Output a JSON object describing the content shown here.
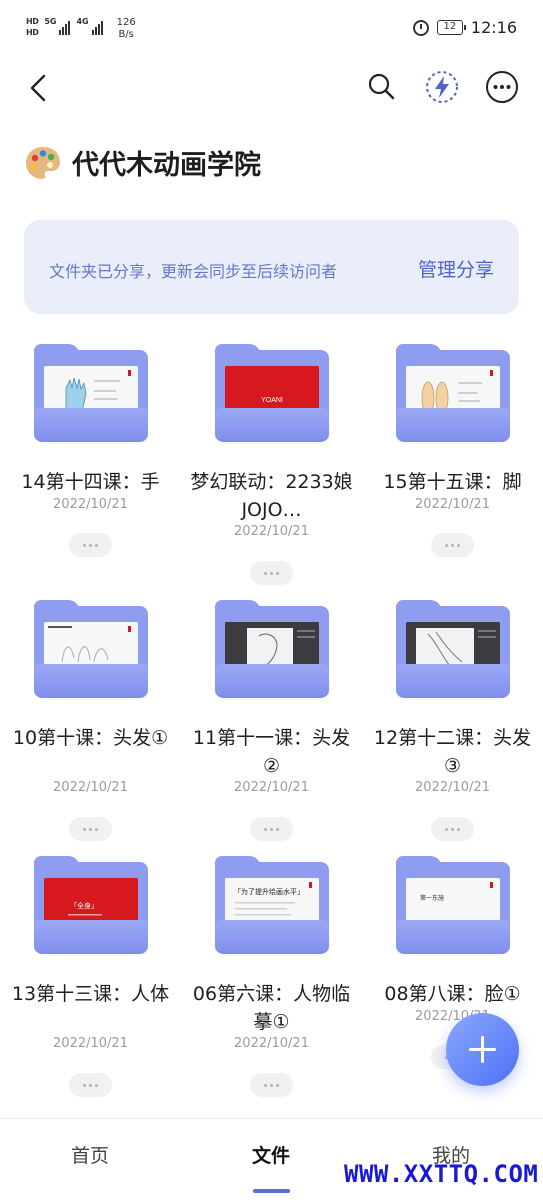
{
  "status_bar": {
    "sim1": "HD",
    "sim2": "HD",
    "net1": "5G",
    "net2": "4G",
    "speed_value": "126",
    "speed_unit": "B/s",
    "battery": "12",
    "time": "12:16"
  },
  "header": {
    "icons": [
      "back-arrow-icon",
      "search-icon",
      "lightning-icon",
      "more-icon"
    ]
  },
  "folder": {
    "emoji": "🎨",
    "title": "代代木动画学院"
  },
  "share_banner": {
    "message": "文件夹已分享，更新会同步至后续访问者",
    "action": "管理分享"
  },
  "items": [
    {
      "name": "14第十四课：手",
      "date": "2022/10/21",
      "thumb": "hand"
    },
    {
      "name": "梦幻联动：2233娘JOJO…",
      "date": "2022/10/21",
      "thumb": "red",
      "thumb_text": "YOANI"
    },
    {
      "name": "15第十五课：脚",
      "date": "2022/10/21",
      "thumb": "feet"
    },
    {
      "name": "10第十课：头发①",
      "date": "2022/10/21",
      "thumb": "sketch"
    },
    {
      "name": "11第十一课：头发②",
      "date": "2022/10/21",
      "thumb": "dark"
    },
    {
      "name": "12第十二课：头发③",
      "date": "2022/10/21",
      "thumb": "dark"
    },
    {
      "name": "13第十三课：人体",
      "date": "2022/10/21",
      "thumb": "red",
      "thumb_text": "「全身」"
    },
    {
      "name": "06第六课：人物临摹①",
      "date": "2022/10/21",
      "thumb": "white",
      "thumb_text": "「为了提升绘画水平」"
    },
    {
      "name": "08第八课：脸①",
      "date": "2022/10/21",
      "thumb": "white",
      "thumb_text": "第一东施"
    }
  ],
  "tabs": [
    {
      "label": "首页",
      "active": false
    },
    {
      "label": "文件",
      "active": true
    },
    {
      "label": "我的",
      "active": false
    }
  ],
  "watermark": "WWW.XXTTQ.COM",
  "colors": {
    "accent": "#5b6fd6",
    "folder": "#8f9df0",
    "banner_bg": "#eaeefb"
  }
}
